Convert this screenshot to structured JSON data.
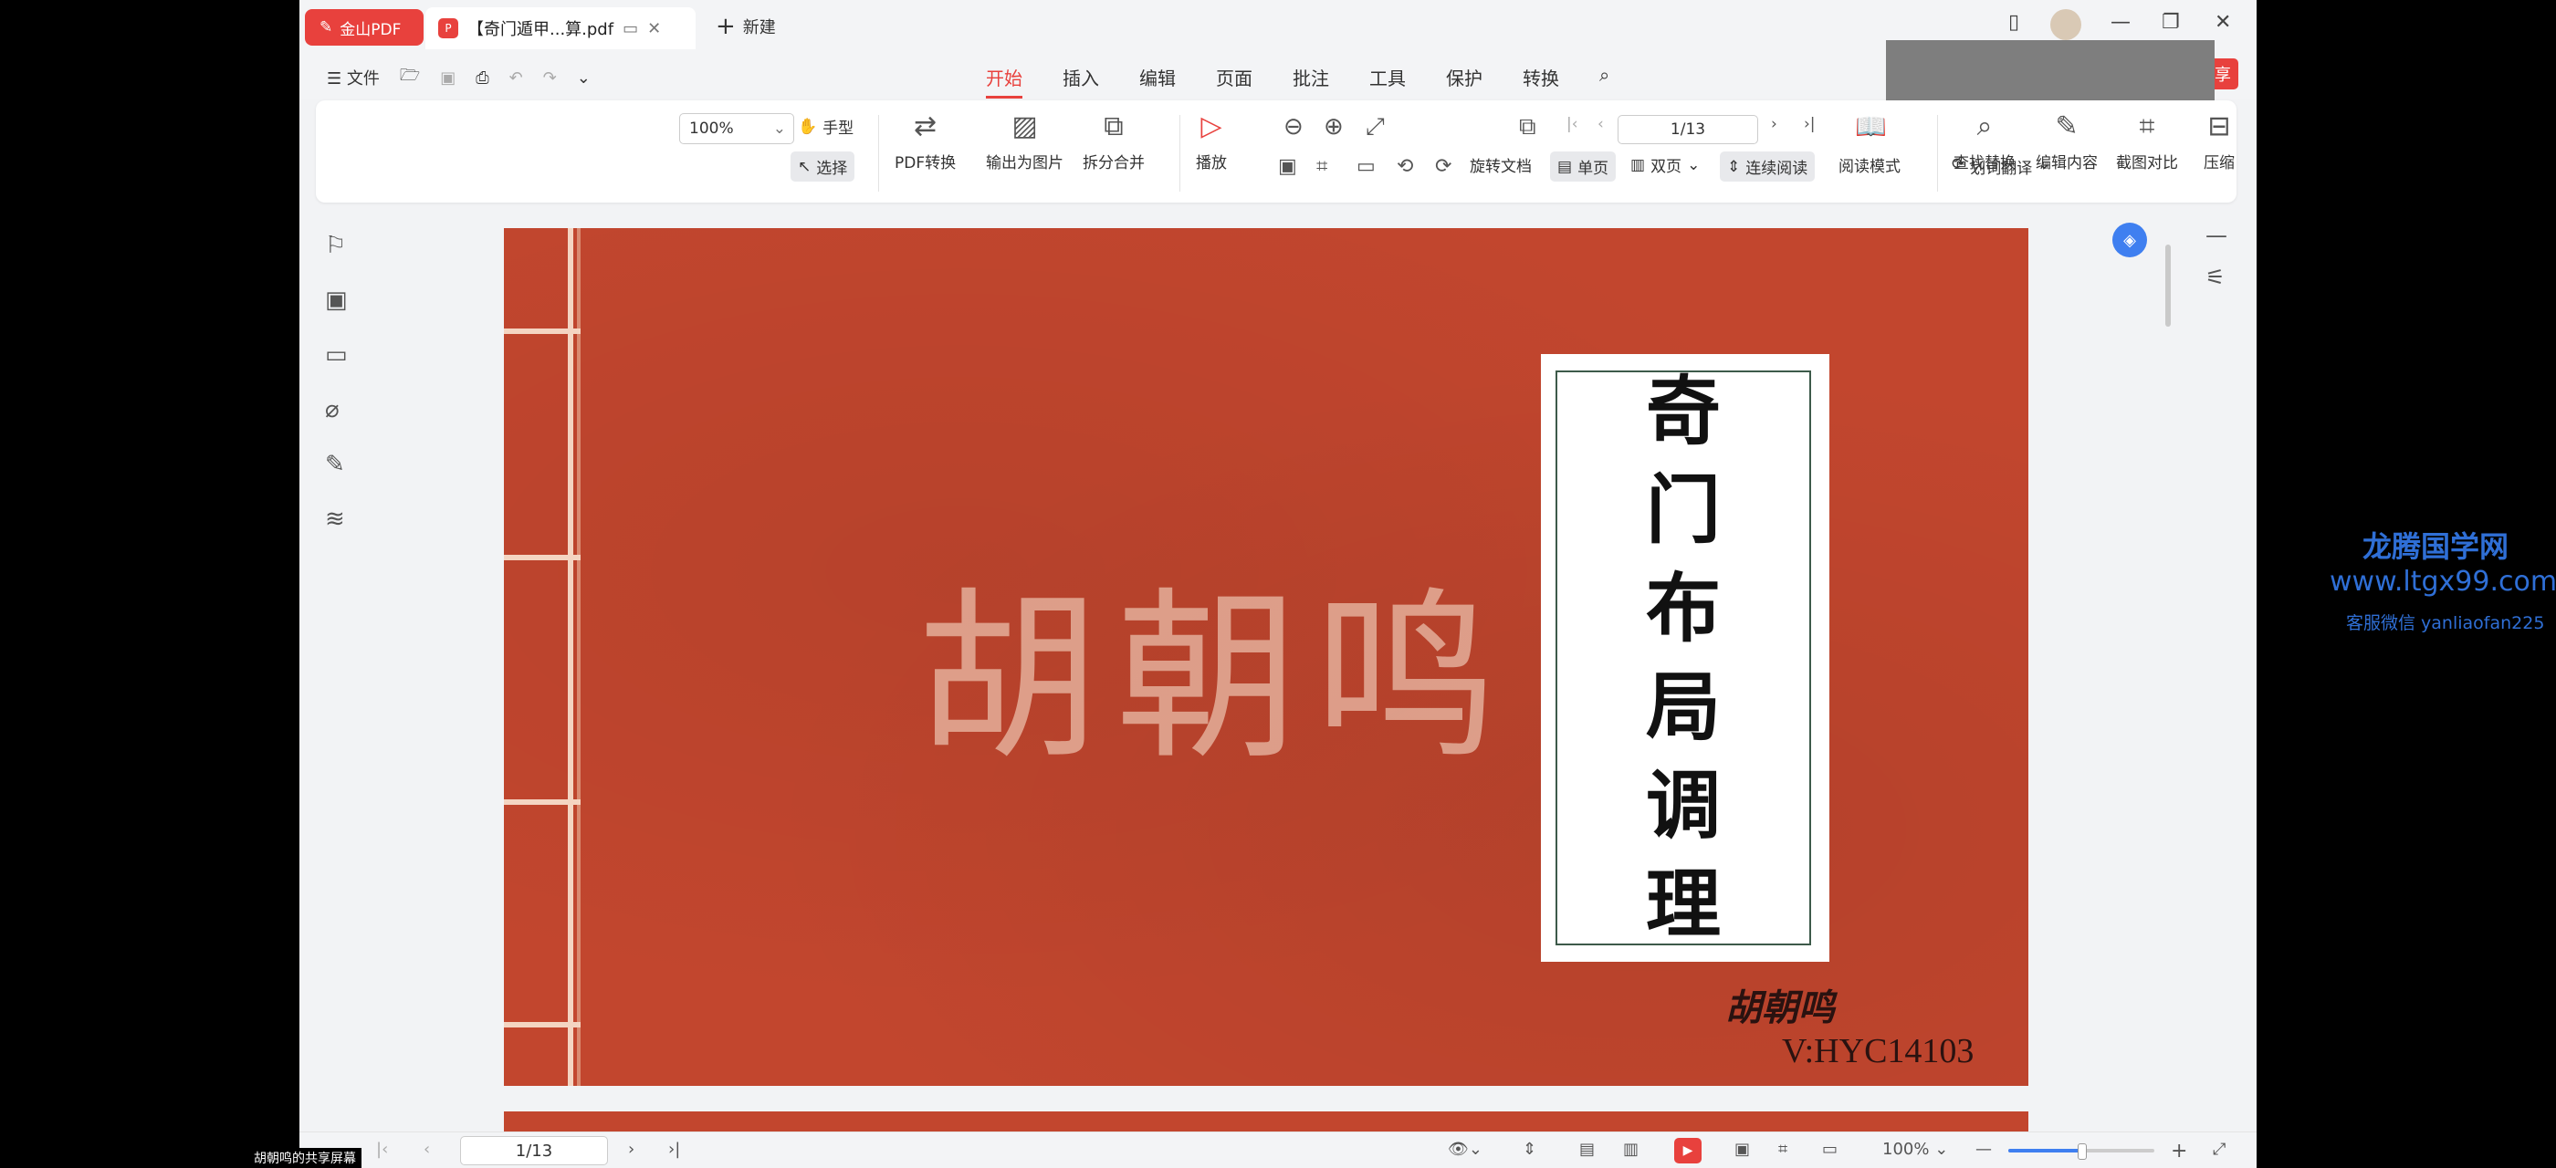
{
  "titlebar": {
    "app_name": "金山PDF",
    "doc_tab": "【奇门遁甲...算.pdf",
    "new_tab": "新建"
  },
  "menubar": {
    "file": "文件",
    "tabs": [
      "开始",
      "插入",
      "编辑",
      "页面",
      "批注",
      "工具",
      "保护",
      "转换"
    ],
    "active_tab": "开始",
    "share": "享"
  },
  "ribbon": {
    "hand": "手型",
    "select": "选择",
    "pdf_convert": "PDF转换",
    "export_image": "输出为图片",
    "split_merge": "拆分合并",
    "play": "播放",
    "zoom": "100%",
    "page": "1/13",
    "rotate": "旋转文档",
    "single_page": "单页",
    "double_page": "双页",
    "continuous": "连续阅读",
    "read_mode": "阅读模式",
    "find_replace": "查找替换",
    "edit_content": "编辑内容",
    "screenshot_compare": "截图对比",
    "compress": "压缩",
    "translate": "划词翻译"
  },
  "document": {
    "watermark": "胡朝鸣",
    "title_chars": [
      "奇",
      "门",
      "布",
      "局",
      "调",
      "理"
    ],
    "signature": "胡朝鸣",
    "code": "V:HYC14103"
  },
  "statusbar": {
    "page": "1/13",
    "zoom": "100%",
    "zoom_fraction": 0.5
  },
  "overlay": {
    "share_label": "胡朝鸣的共享屏幕",
    "promo_name": "龙腾国学网",
    "promo_url": "www.ltgx99.com",
    "promo_wechat": "客服微信 yanliaofan225"
  },
  "colors": {
    "accent": "#e8413d",
    "cover_red": "#c2462e",
    "promo_blue": "#2f6fd6"
  }
}
